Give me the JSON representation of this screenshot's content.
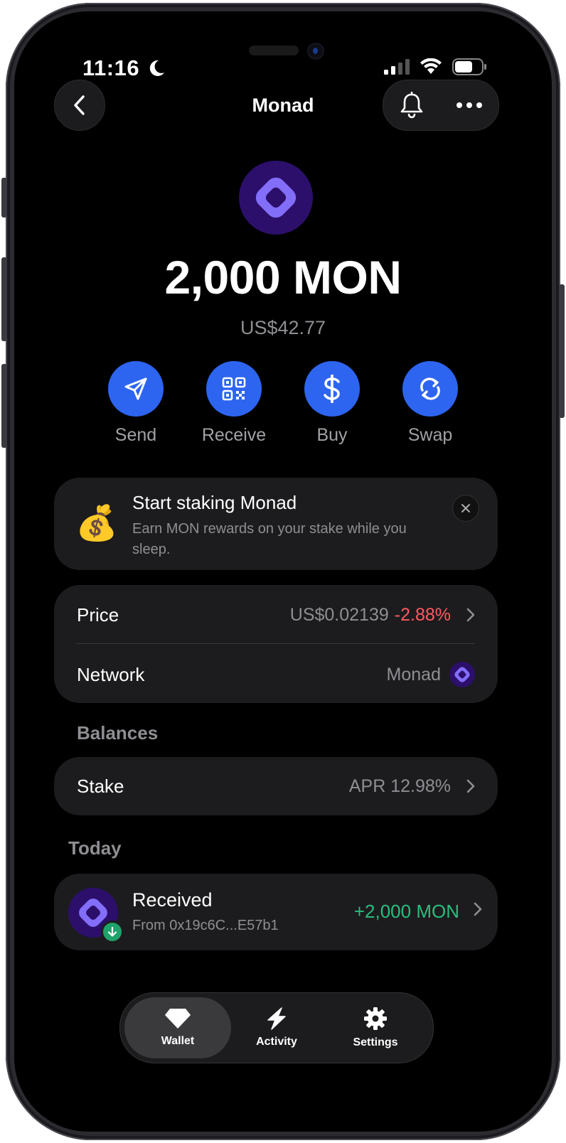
{
  "status": {
    "time": "11:16"
  },
  "header": {
    "title": "Monad"
  },
  "asset": {
    "amount": "2,000 MON",
    "fiat_value": "US$42.77"
  },
  "actions": [
    {
      "label": "Send",
      "icon": "send-icon"
    },
    {
      "label": "Receive",
      "icon": "qr-code-icon"
    },
    {
      "label": "Buy",
      "icon": "dollar-icon"
    },
    {
      "label": "Swap",
      "icon": "swap-icon"
    }
  ],
  "promo": {
    "title": "Start staking Monad",
    "subtitle": "Earn MON rewards on your stake while you sleep.",
    "icon": "money-bag-icon"
  },
  "details": {
    "price_label": "Price",
    "price_value": "US$0.02139",
    "price_change": "-2.88%",
    "network_label": "Network",
    "network_value": "Monad"
  },
  "balances": {
    "section_title": "Balances",
    "stake_label": "Stake",
    "stake_value": "APR 12.98%"
  },
  "activity": {
    "section_title": "Today",
    "items": [
      {
        "title": "Received",
        "subtitle": "From 0x19c6C...E57b1",
        "amount": "+2,000 MON"
      }
    ]
  },
  "tabbar": {
    "tabs": [
      {
        "label": "Wallet",
        "icon": "gem-icon",
        "active": true
      },
      {
        "label": "Activity",
        "icon": "lightning-icon",
        "active": false
      },
      {
        "label": "Settings",
        "icon": "gear-icon",
        "active": false
      }
    ]
  },
  "colors": {
    "accent": "#2d64f0",
    "negative": "#ff5a5f",
    "positive": "#2bbd7e",
    "monad_purple": "#836ef9"
  }
}
